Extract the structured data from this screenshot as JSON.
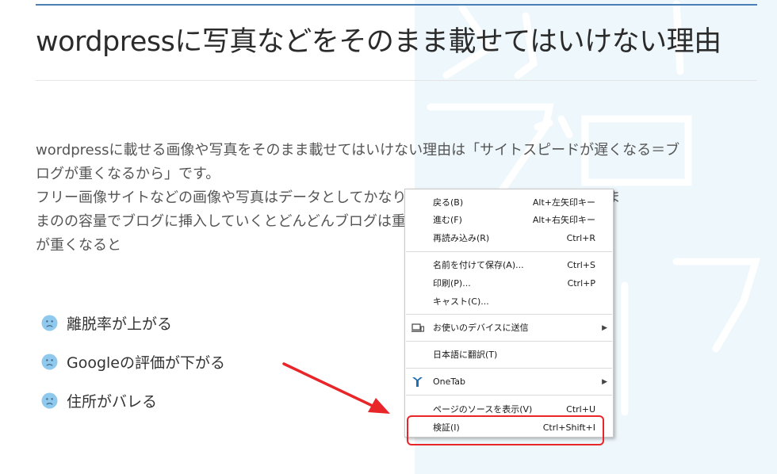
{
  "article": {
    "title": "wordpressに写真などをそのまま載せてはいけない理由",
    "paragraphs": [
      "wordpressに載せる画像や写真をそのまま載せてはいけない理由は「サイトスピードが遅くなる＝ブ",
      "ログが重くなるから」です。",
      "フリー画像サイトなどの画像や写真はデータとしてかなり重いものが多く、それらをそのま",
      "まのの容量でブログに挿入していくとどんどんブログは重くなっていきます。ブログ",
      "が重くなると"
    ],
    "list": [
      {
        "text": "離脱率が上がる",
        "icon": "sad-face-icon"
      },
      {
        "text": "Googleの評価が下がる",
        "icon": "sad-face-icon"
      },
      {
        "text": "住所がバレる",
        "icon": "sad-face-icon"
      }
    ]
  },
  "context_menu": {
    "items": [
      {
        "label": "戻る(B)",
        "shortcut": "Alt+左矢印キー"
      },
      {
        "label": "進む(F)",
        "shortcut": "Alt+右矢印キー"
      },
      {
        "label": "再読み込み(R)",
        "shortcut": "Ctrl+R"
      },
      {
        "label": "名前を付けて保存(A)...",
        "shortcut": "Ctrl+S"
      },
      {
        "label": "印刷(P)...",
        "shortcut": "Ctrl+P"
      },
      {
        "label": "キャスト(C)...",
        "shortcut": ""
      },
      {
        "label": "お使いのデバイスに送信",
        "shortcut": "",
        "icon": "device-send-icon",
        "submenu": true
      },
      {
        "label": "日本語に翻訳(T)",
        "shortcut": ""
      },
      {
        "label": "OneTab",
        "shortcut": "",
        "icon": "onetab-icon",
        "submenu": true
      },
      {
        "label": "ページのソースを表示(V)",
        "shortcut": "Ctrl+U"
      },
      {
        "label": "検証(I)",
        "shortcut": "Ctrl+Shift+I"
      }
    ]
  },
  "colors": {
    "accent_rule": "#4a7fb8",
    "highlight_box": "#e8262a",
    "arrow": "#e8262a",
    "icon_blue": "#8fc9ee"
  }
}
